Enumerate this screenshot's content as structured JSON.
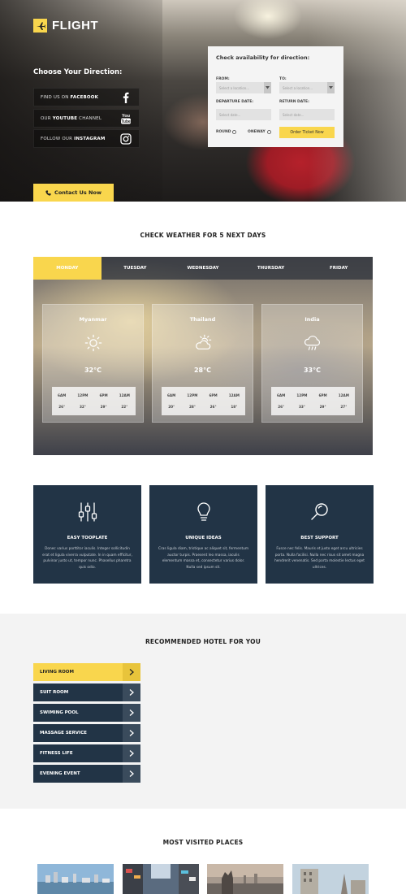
{
  "header": {
    "brand": "FLIGHT"
  },
  "hero": {
    "direction_title": "Choose Your Direction:",
    "social": [
      {
        "pre": "FIND US ON ",
        "bold": "FACEBOOK",
        "icon": "facebook-icon"
      },
      {
        "pre": "OUR ",
        "bold": "YOUTUBE",
        "post": " CHANNEL",
        "icon": "youtube-icon"
      },
      {
        "pre": "FOLLOW OUR ",
        "bold": "INSTAGRAM",
        "icon": "instagram-icon"
      }
    ],
    "contact_label": "Contact Us Now"
  },
  "booking": {
    "title": "Check availability for direction:",
    "from_label": "FROM:",
    "from_placeholder": "Select a location...",
    "to_label": "TO:",
    "to_placeholder": "Select a location...",
    "departure_label": "DEPARTURE DATE:",
    "departure_placeholder": "Select date...",
    "return_label": "RETURN DATE:",
    "return_placeholder": "Select date...",
    "radio_round": "ROUND",
    "radio_oneway": "ONEWAY",
    "order_label": "Order Ticket Now"
  },
  "weather": {
    "title": "CHECK WEATHER FOR 5 NEXT DAYS",
    "tabs": [
      "MONDAY",
      "TUESDAY",
      "WEDNESDAY",
      "THURSDAY",
      "FRIDAY"
    ],
    "active_tab": "MONDAY",
    "cards": [
      {
        "city": "Myanmar",
        "temp": "32°C",
        "icon": "sun-icon",
        "hours": [
          "6AM",
          "12PM",
          "6PM",
          "12AM"
        ],
        "temps": [
          "26°",
          "32°",
          "29°",
          "22°"
        ]
      },
      {
        "city": "Thailand",
        "temp": "28°C",
        "icon": "partly-cloudy-icon",
        "hours": [
          "6AM",
          "12PM",
          "6PM",
          "12AM"
        ],
        "temps": [
          "20°",
          "28°",
          "26°",
          "18°"
        ]
      },
      {
        "city": "India",
        "temp": "33°C",
        "icon": "rain-cloud-icon",
        "hours": [
          "6AM",
          "12PM",
          "6PM",
          "12AM"
        ],
        "temps": [
          "26°",
          "33°",
          "29°",
          "27°"
        ]
      }
    ]
  },
  "features": [
    {
      "title": "EASY TOOPLATE",
      "icon": "sliders-icon",
      "text": "Donec varius porttitor iaculis. Integer sollicitudin erat et ligula viverra vulputate. In in quam efficitur, pulvinar justo ut, tempor nunc. Phasellus pharetra quis odio."
    },
    {
      "title": "UNIQUE IDEAS",
      "icon": "lightbulb-icon",
      "text": "Cras ligula diam, tristique ac aliquet sit, fermentum auctor turpis. Praesent leo massa, iaculis elementum massa et, consectetur varius dolor. Nulla sed ipsum sit."
    },
    {
      "title": "BEST SUPPORT",
      "icon": "magnifier-icon",
      "text": "Fusce nec felis. Mauris et justo eget arcu ultricies porta. Nulla facilisi. Nulla nec risus sit amet magna hendrerit venenatis. Sed porta molestie lectus eget ultrices."
    }
  ],
  "hotel": {
    "title": "RECOMMENDED HOTEL FOR YOU",
    "items": [
      "LIVING ROOM",
      "SUIT ROOM",
      "SWIMING POOL",
      "MASSAGE SERVICE",
      "FITNESS LIFE",
      "EVENING EVENT"
    ],
    "active_item": "LIVING ROOM"
  },
  "places": {
    "title": "MOST VISITED PLACES",
    "images": [
      "city-harbor-photo",
      "street-photo",
      "gargoyle-city-photo",
      "tower-photo"
    ]
  },
  "colors": {
    "accent": "#f9d64d",
    "navy": "#223446"
  }
}
